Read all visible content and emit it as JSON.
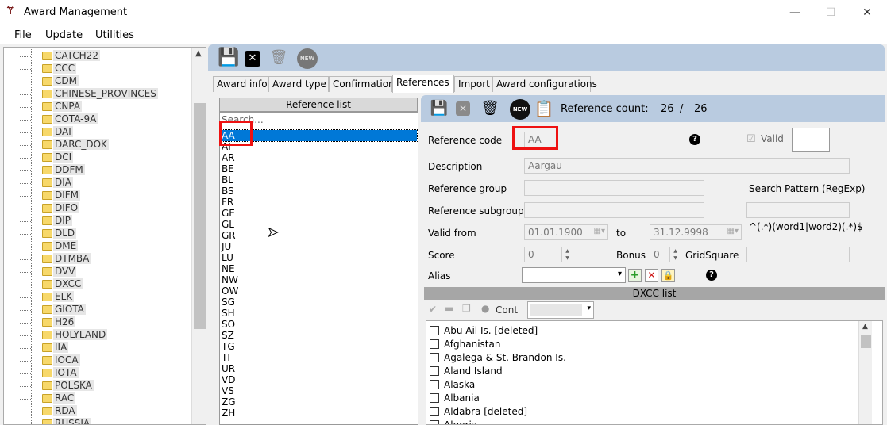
{
  "window": {
    "title": "Award Management",
    "minimize": "—",
    "maximize": "☐",
    "close": "✕"
  },
  "menu": [
    "File",
    "Update",
    "Utilities"
  ],
  "tree": {
    "items": [
      "CATCH22",
      "CCC",
      "CDM",
      "CHINESE_PROVINCES",
      "CNPA",
      "COTA-9A",
      "DAI",
      "DARC_DOK",
      "DCI",
      "DDFM",
      "DIA",
      "DIFM",
      "DIFO",
      "DIP",
      "DLD",
      "DME",
      "DTMBA",
      "DVV",
      "DXCC",
      "ELK",
      "GIOTA",
      "H26",
      "HOLYLAND",
      "IIA",
      "IOCA",
      "IOTA",
      "POLSKA",
      "RAC",
      "RDA",
      "RUSSIA"
    ]
  },
  "tabs": [
    "Award info",
    "Award type",
    "Confirmation",
    "References",
    "Import",
    "Award configurations"
  ],
  "active_tab": "References",
  "reference_list": {
    "header": "Reference list",
    "search_placeholder": "Search...",
    "items": [
      "AA",
      "AI",
      "AR",
      "BE",
      "BL",
      "BS",
      "FR",
      "GE",
      "GL",
      "GR",
      "JU",
      "LU",
      "NE",
      "NW",
      "OW",
      "SG",
      "SH",
      "SO",
      "SZ",
      "TG",
      "TI",
      "UR",
      "VD",
      "VS",
      "ZG",
      "ZH"
    ],
    "selected": "AA"
  },
  "ref_toolbar": {
    "count_label": "Reference count:",
    "count_current": "26",
    "count_sep": "/",
    "count_total": "26"
  },
  "form": {
    "ref_code_label": "Reference code",
    "ref_code": "AA",
    "valid_label": "Valid",
    "description_label": "Description",
    "description": "Aargau",
    "group_label": "Reference group",
    "subgroup_label": "Reference subgroup",
    "search_pattern_label": "Search Pattern (RegExp)",
    "search_pattern_hint": "^(.*)(word1|word2)(.*)$",
    "valid_from_label": "Valid from",
    "valid_from": "01.01.1900",
    "to_label": "to",
    "valid_to": "31.12.9998",
    "score_label": "Score",
    "score": "0",
    "bonus_label": "Bonus",
    "bonus": "0",
    "gridsquare_label": "GridSquare",
    "alias_label": "Alias"
  },
  "dxcc": {
    "header": "DXCC list",
    "cont_label": "Cont",
    "items": [
      "Abu Ail Is. [deleted]",
      "Afghanistan",
      "Agalega & St. Brandon Is.",
      "Aland Island",
      "Alaska",
      "Albania",
      "Aldabra [deleted]",
      "Algeria"
    ]
  },
  "colors": {
    "accent": "#0078d7",
    "highlight": "#e11111",
    "toolbar": "#b9cbe0"
  }
}
